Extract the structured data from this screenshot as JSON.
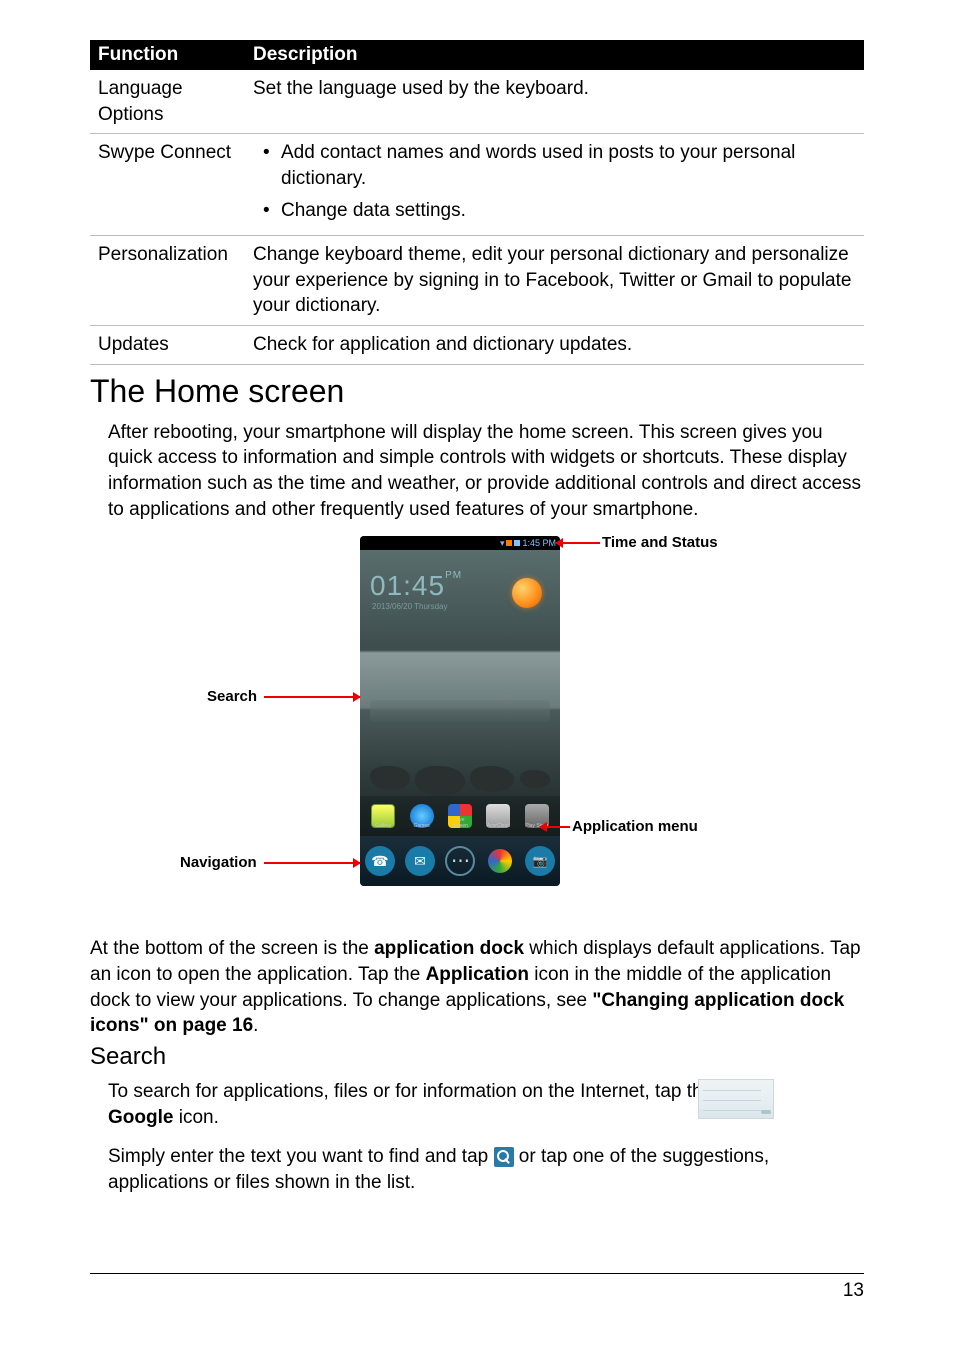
{
  "table": {
    "headers": {
      "func": "Function",
      "desc": "Description"
    },
    "rows": {
      "lang": {
        "func": "Language Options",
        "desc": "Set the language used by the keyboard."
      },
      "swype": {
        "func": "Swype Connect",
        "b1": "Add contact names and words used in posts to your personal dictionary.",
        "b2": "Change data settings."
      },
      "pers": {
        "func": "Personalization",
        "desc": "Change keyboard theme, edit your personal dictionary and personalize your experience by signing in to Facebook, Twitter or Gmail to populate your dictionary."
      },
      "upd": {
        "func": "Updates",
        "desc": "Check for application and dictionary updates."
      }
    }
  },
  "h1": "The Home screen",
  "intro": "After rebooting, your smartphone will display the home screen. This screen gives you quick access to information and simple controls with widgets or shortcuts. These display information such as the time and weather, or provide additional controls and direct access to applications and other frequently used features of your smartphone.",
  "callouts": {
    "time_status": "Time and Status",
    "search": "Search",
    "app_menu": "Application menu",
    "navigation": "Navigation"
  },
  "phone": {
    "clock_time": "01:45",
    "clock_ampm": "PM",
    "clock_date": "2013/06/20 Thursday",
    "status_time": "1:45 PM",
    "apps": {
      "a1": "Gallery",
      "a2": "Games",
      "a3": "Live Screen",
      "a4": "AcerCloud",
      "a5": "Play Store"
    }
  },
  "bottom_para": {
    "t1": "At the bottom of the screen is the ",
    "b1": "application dock",
    "t2": " which displays default applications. Tap an icon to open the application. Tap the ",
    "b2": "Application",
    "t3": " icon in the middle of the application dock to view your applications. To change applications, see ",
    "b3": "\"Changing application dock icons\" on page 16",
    "t4": "."
  },
  "h2": "Search",
  "search_para": {
    "t1": "To search for applications, files or for information on the Internet, tap the ",
    "b1": "Google",
    "t2": " icon."
  },
  "tap_para": {
    "t1": "Simply enter the text you want to find and tap ",
    "t2": " or tap one of the suggestions, applications or files shown in the list."
  },
  "page_number": "13"
}
